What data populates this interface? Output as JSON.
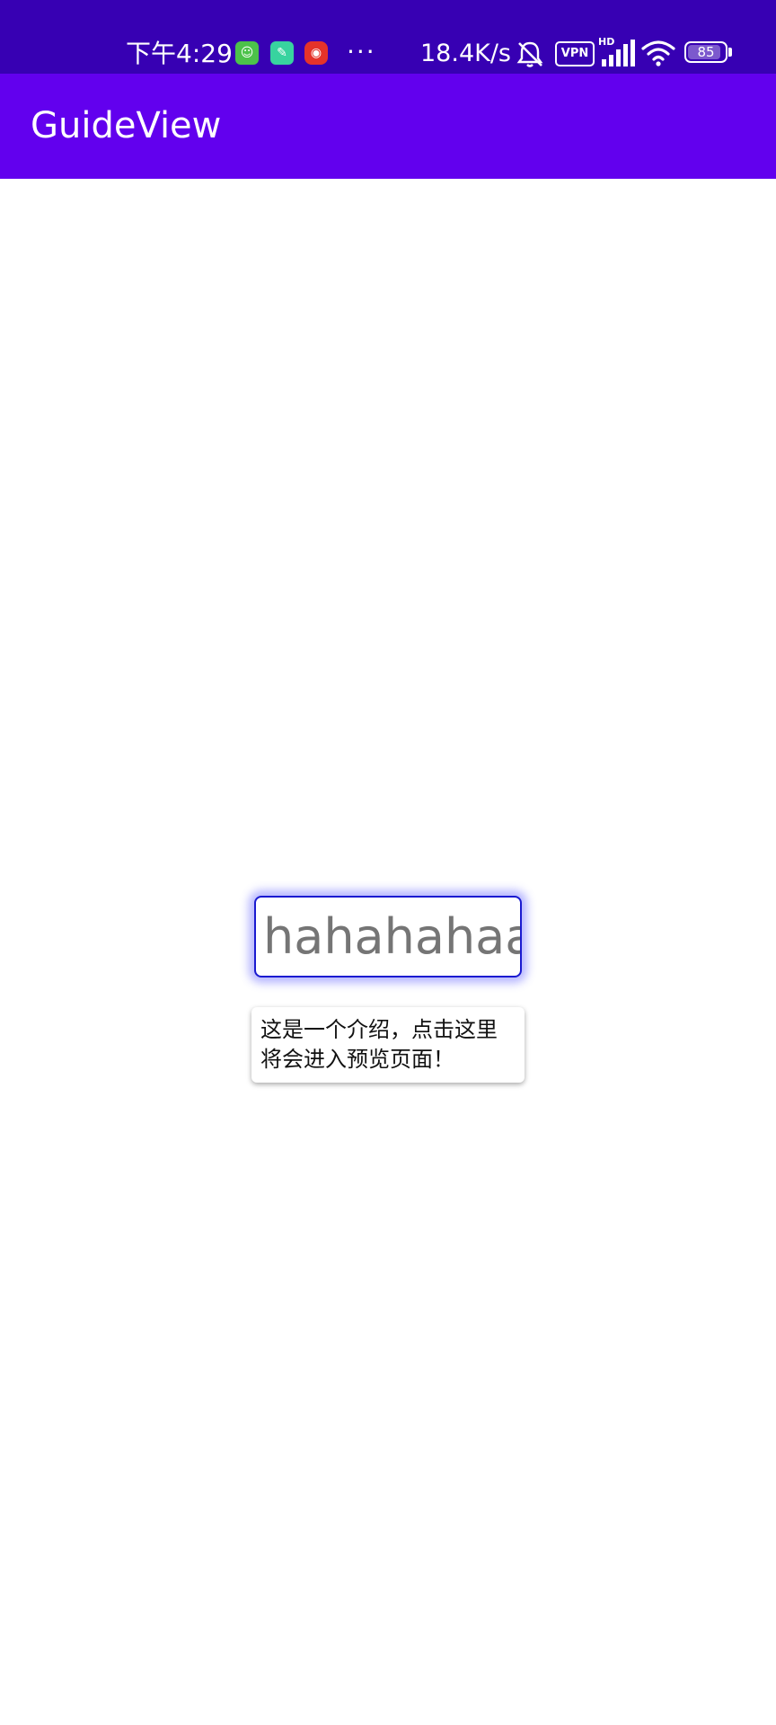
{
  "status_bar": {
    "time": "下午4:29",
    "notification_icons": [
      "cat-app-icon",
      "wrench-app-icon",
      "red-app-icon"
    ],
    "more_indicator": "···",
    "network_speed": "18.4K/s",
    "vpn_label": "VPN",
    "hd_label": "HD",
    "battery_level": "85",
    "background_color": "#3700b3"
  },
  "app_bar": {
    "title": "GuideView",
    "background_color": "#6200ee"
  },
  "main": {
    "target_text": "hahahahaa",
    "guide_tooltip": "这是一个介绍，点击这里将会进入预览页面！",
    "highlight_color": "#1a1ad0"
  }
}
